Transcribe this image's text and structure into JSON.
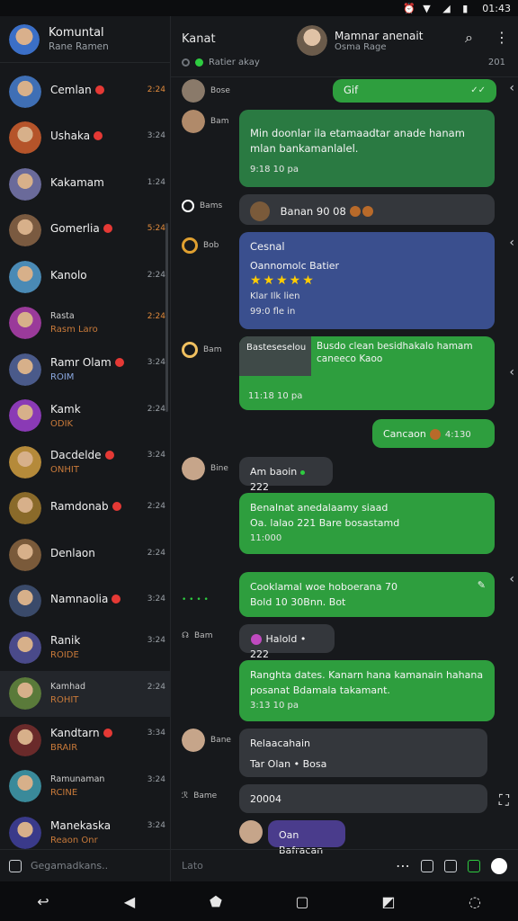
{
  "statusbar": {
    "time": "01:43"
  },
  "sidebar": {
    "title": "Komuntal",
    "subtitle": "Rane Ramen",
    "footer_placeholder": "Gegamadkans..",
    "chats": [
      {
        "name": "Cemlan",
        "time": "2:24",
        "preview": "",
        "red": true,
        "color": "#3f6fb5"
      },
      {
        "name": "Ushaka",
        "time": "3:24",
        "preview": "",
        "red": true,
        "color": "#b5542a"
      },
      {
        "name": "Kakamam",
        "time": "1:24",
        "preview": "",
        "red": false,
        "color": "#6a6a9a"
      },
      {
        "name": "Gomerlia",
        "time": "5:24",
        "preview": "",
        "red": true,
        "color": "#7a5a40"
      },
      {
        "name": "Kanolo",
        "time": "2:24",
        "preview": "",
        "red": false,
        "color": "#4a8ab5"
      },
      {
        "name": "Rasta",
        "time": "2:24",
        "preview": "Rasm Laro",
        "red": false,
        "color": "#9a3a9a",
        "small": true
      },
      {
        "name": "Ramr Olam",
        "time": "3:24",
        "preview": "ROIM",
        "red": true,
        "color": "#4a5a8a",
        "blue": true
      },
      {
        "name": "Kamk",
        "time": "2:24",
        "preview": "ODIK",
        "red": false,
        "color": "#8a3ab5"
      },
      {
        "name": "Dacdelde",
        "time": "3:24",
        "preview": "ONHIT",
        "red": true,
        "color": "#b58a3a"
      },
      {
        "name": "Ramdonab",
        "time": "2:24",
        "preview": "",
        "red": true,
        "color": "#8a6a2a"
      },
      {
        "name": "Denlaon",
        "time": "2:24",
        "preview": "",
        "red": false,
        "color": "#7a5a3a"
      },
      {
        "name": "Namnaolia",
        "time": "3:24",
        "preview": "",
        "red": true,
        "color": "#3a4a6a"
      },
      {
        "name": "Ranik",
        "time": "3:24",
        "preview": "ROIDE",
        "red": false,
        "color": "#4a4a8a"
      },
      {
        "name": "Kamhad",
        "time": "2:24",
        "preview": "ROHIT",
        "red": false,
        "color": "#5a7a3a",
        "small": true
      },
      {
        "name": "Kandtarn",
        "time": "3:34",
        "preview": "BRAIR",
        "red": true,
        "color": "#6a2a2a"
      },
      {
        "name": "Ramunaman",
        "time": "3:24",
        "preview": "RCINE",
        "red": false,
        "color": "#3a8a9a",
        "small": true
      },
      {
        "name": "Manekaska",
        "time": "3:24",
        "preview": "Reaon Onr",
        "red": false,
        "color": "#3a3a8a"
      }
    ]
  },
  "main": {
    "left_title": "Kanat",
    "contact_name": "Mamnar anenait",
    "contact_sub": "Osma Rage",
    "status": "Ratier akay",
    "count": "201",
    "footer_placeholder": "Lato",
    "messages": {
      "m1_sender": "Bose",
      "m1_text": "Gif",
      "m2_sender": "Bam",
      "m2_text": "Min doonlar ila etamaadtar anade hanam mlan bankamanlalel.",
      "m2_meta": "9:18 10 pa",
      "m3_sender": "Bams",
      "m3_text": "Banan 90 08",
      "m4_sender": "Bob",
      "m4_title": "Cesnal",
      "m4_sub": "Oannomolc Batier",
      "m4_meta": "Klar Ilk lien",
      "m4_meta2": "99:0 fle in",
      "m5_sender": "Bam",
      "m5_left": "Basteseselou",
      "m5_right": "Busdo clean besidhakalo hamam caneeco",
      "m5_right2": "Kaoo",
      "m5_meta": "11:18 10 pa",
      "m6_text": "Cancaon",
      "m6_meta": "4:130",
      "m7_sender": "Bine",
      "m7_text": "Am baoin",
      "m7_count": "222",
      "m8_text": "Benalnat anedalaamy siaad",
      "m8_text2": "Oa. lalao 221 Bare bosastamd",
      "m8_meta": "11:000",
      "m9_text": "Cooklamal woe hoboerana 70",
      "m9_text2": "Bold 10 30Bnn. Bot",
      "m10_sender": "Bam",
      "m10_text": "Halold",
      "m10_count": "222",
      "m11_text": "Ranghta dates. Kanarn hana kamanain hahana",
      "m11_text2": "posanat Bdamala takamant.",
      "m11_meta": "3:13 10 pa",
      "m12_sender": "Bane",
      "m12_title": "Relaacahain",
      "m12_sub": "Tar Olan",
      "m12_sub2": "Bosa",
      "m13_sender": "Bame",
      "m13_text": "20004",
      "m14_text": "Oan Bafracan"
    }
  }
}
